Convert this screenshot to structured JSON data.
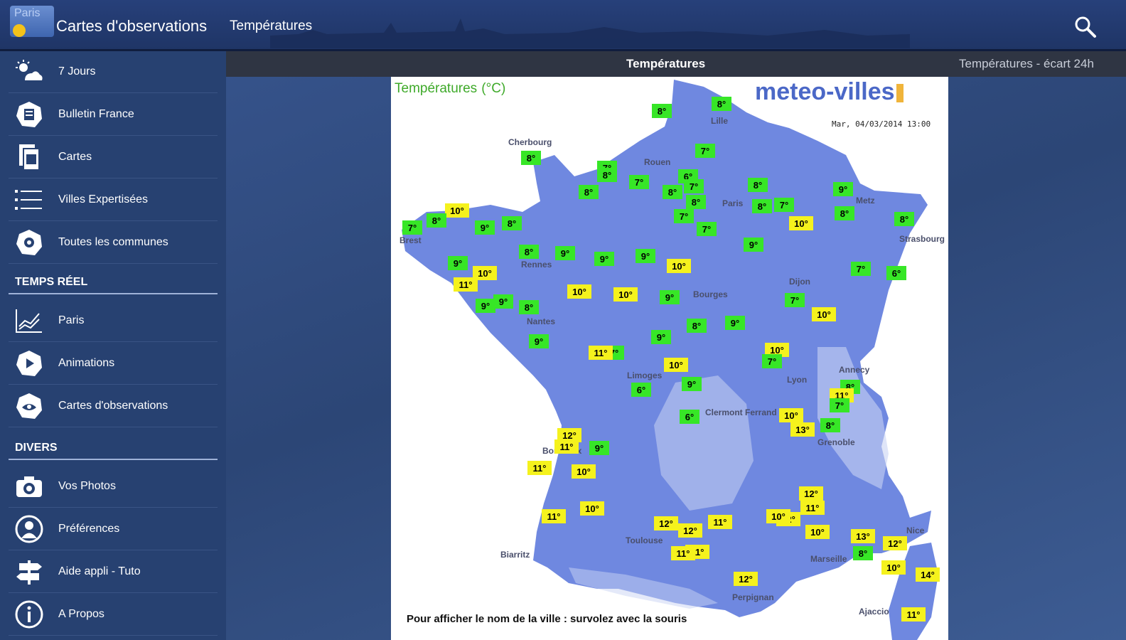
{
  "header": {
    "logo_text": "Paris",
    "title": "Cartes d'observations",
    "tab": "Températures"
  },
  "sidebar": {
    "items": [
      {
        "label": "7 Jours",
        "icon": "sun-cloud-icon"
      },
      {
        "label": "Bulletin France",
        "icon": "france-bulletin-icon"
      },
      {
        "label": "Cartes",
        "icon": "maps-icon"
      },
      {
        "label": "Villes Expertisées",
        "icon": "list-icon"
      },
      {
        "label": "Toutes les communes",
        "icon": "communes-icon"
      }
    ],
    "section_realtime": "TEMPS RÉEL",
    "realtime_items": [
      {
        "label": "Paris",
        "icon": "chart-icon"
      },
      {
        "label": "Animations",
        "icon": "animation-icon"
      },
      {
        "label": "Cartes d'observations",
        "icon": "observations-icon"
      }
    ],
    "section_misc": "DIVERS",
    "misc_items": [
      {
        "label": "Vos Photos",
        "icon": "camera-icon"
      },
      {
        "label": "Préférences",
        "icon": "user-icon"
      },
      {
        "label": "Aide appli - Tuto",
        "icon": "signpost-icon"
      },
      {
        "label": "A Propos",
        "icon": "info-icon"
      }
    ]
  },
  "tabs": {
    "active": "Températures",
    "next": "Températures - écart 24h"
  },
  "map": {
    "title": "Températures",
    "unit": "(°C)",
    "brand": "meteo-villes",
    "date": "Mar, 04/03/2014 13:00",
    "footer": "Pour afficher le nom de la ville : survolez avec la souris",
    "cities": [
      "Lille",
      "Cherbourg",
      "Rouen",
      "Paris",
      "Metz",
      "Strasbourg",
      "Brest",
      "Rennes",
      "Bourges",
      "Dijon",
      "Nantes",
      "Limoges",
      "Annecy",
      "Lyon",
      "Clermont Ferrand",
      "Grenoble",
      "Bordeaux",
      "Biarritz",
      "Toulouse",
      "Marseille",
      "Nice",
      "Perpignan",
      "Ajaccio"
    ],
    "colors": {
      "cold": "#37e627",
      "warm": "#f5f21d",
      "land": "#6f88e0",
      "relief": "#c9d3f3"
    },
    "temps": [
      {
        "v": "8°"
      },
      {
        "v": "8°"
      },
      {
        "v": "8°"
      },
      {
        "v": "7°"
      },
      {
        "v": "8°"
      },
      {
        "v": "7°"
      },
      {
        "v": "7°"
      },
      {
        "v": "6°"
      },
      {
        "v": "7°"
      },
      {
        "v": "8°"
      },
      {
        "v": "7°"
      },
      {
        "v": "8°"
      },
      {
        "v": "8°"
      },
      {
        "v": "8°"
      },
      {
        "v": "7°"
      },
      {
        "v": "9°"
      },
      {
        "v": "8°"
      },
      {
        "v": "8°"
      },
      {
        "v": "8°"
      },
      {
        "v": "7°"
      },
      {
        "v": "10°"
      },
      {
        "v": "10°"
      },
      {
        "v": "9°"
      },
      {
        "v": "7°"
      },
      {
        "v": "8°"
      },
      {
        "v": "9°"
      },
      {
        "v": "8°"
      },
      {
        "v": "8°"
      },
      {
        "v": "9°"
      },
      {
        "v": "9°"
      },
      {
        "v": "9°"
      },
      {
        "v": "10°"
      },
      {
        "v": "9°"
      },
      {
        "v": "7°"
      },
      {
        "v": "6°"
      },
      {
        "v": "11°"
      },
      {
        "v": "10°"
      },
      {
        "v": "9°"
      },
      {
        "v": "9°"
      },
      {
        "v": "10°"
      },
      {
        "v": "10°"
      },
      {
        "v": "9°"
      },
      {
        "v": "7°"
      },
      {
        "v": "10°"
      },
      {
        "v": "8°"
      },
      {
        "v": "8°"
      },
      {
        "v": "9°"
      },
      {
        "v": "9°"
      },
      {
        "v": "9°"
      },
      {
        "v": "7°"
      },
      {
        "v": "10°"
      },
      {
        "v": "10°"
      },
      {
        "v": "9°"
      },
      {
        "v": "7°"
      },
      {
        "v": "8°"
      },
      {
        "v": "11°"
      },
      {
        "v": "10°"
      },
      {
        "v": "6°"
      },
      {
        "v": "11°"
      },
      {
        "v": "7°"
      },
      {
        "v": "12°"
      },
      {
        "v": "13°"
      },
      {
        "v": "11°"
      },
      {
        "v": "10°"
      },
      {
        "v": "10°"
      },
      {
        "v": "9°"
      },
      {
        "v": "6°"
      },
      {
        "v": "8°"
      },
      {
        "v": "11°"
      },
      {
        "v": "11°"
      },
      {
        "v": "12°"
      },
      {
        "v": "11°"
      },
      {
        "v": "12°"
      },
      {
        "v": "10°"
      },
      {
        "v": "8°"
      },
      {
        "v": "12°"
      },
      {
        "v": "12°"
      },
      {
        "v": "11°"
      },
      {
        "v": "11°"
      },
      {
        "v": "12°"
      },
      {
        "v": "10°"
      },
      {
        "v": "11°"
      },
      {
        "v": "13°"
      },
      {
        "v": "12°"
      },
      {
        "v": "10°"
      },
      {
        "v": "14°"
      },
      {
        "v": "11°"
      }
    ]
  }
}
